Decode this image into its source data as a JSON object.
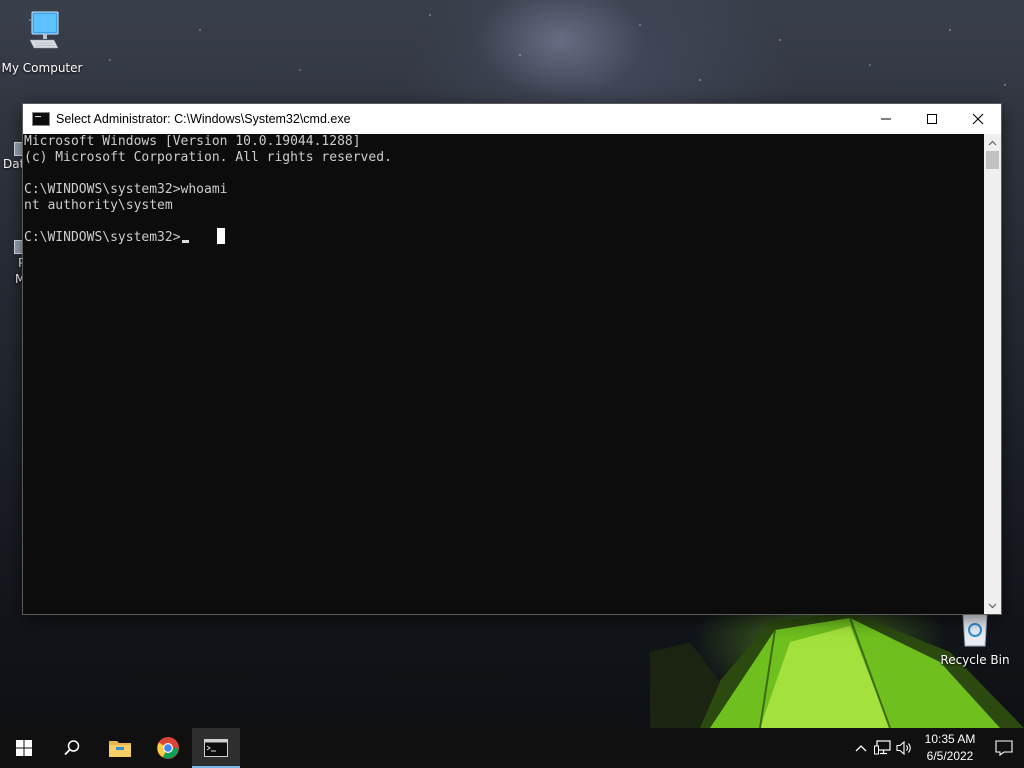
{
  "desktop": {
    "icons": [
      {
        "label": "My Computer"
      },
      {
        "label": "Recycle Bin"
      }
    ],
    "partial_labels": [
      "Data",
      "P",
      "M"
    ]
  },
  "window": {
    "title": "Select Administrator: C:\\Windows\\System32\\cmd.exe",
    "console_lines": [
      "Microsoft Windows [Version 10.0.19044.1288]",
      "(c) Microsoft Corporation. All rights reserved.",
      "",
      "C:\\WINDOWS\\system32>whoami",
      "nt authority\\system",
      ""
    ],
    "prompt": "C:\\WINDOWS\\system32>"
  },
  "taskbar": {
    "apps": [
      "start-icon",
      "search-icon",
      "file-explorer-icon",
      "chrome-icon",
      "cmd-icon"
    ],
    "clock": {
      "time": "10:35 AM",
      "date": "6/5/2022"
    }
  },
  "colors": {
    "console_bg": "#0c0c0c",
    "console_fg": "#cccccc",
    "taskbar_bg": "#101010",
    "accent": "#76b9ed"
  }
}
